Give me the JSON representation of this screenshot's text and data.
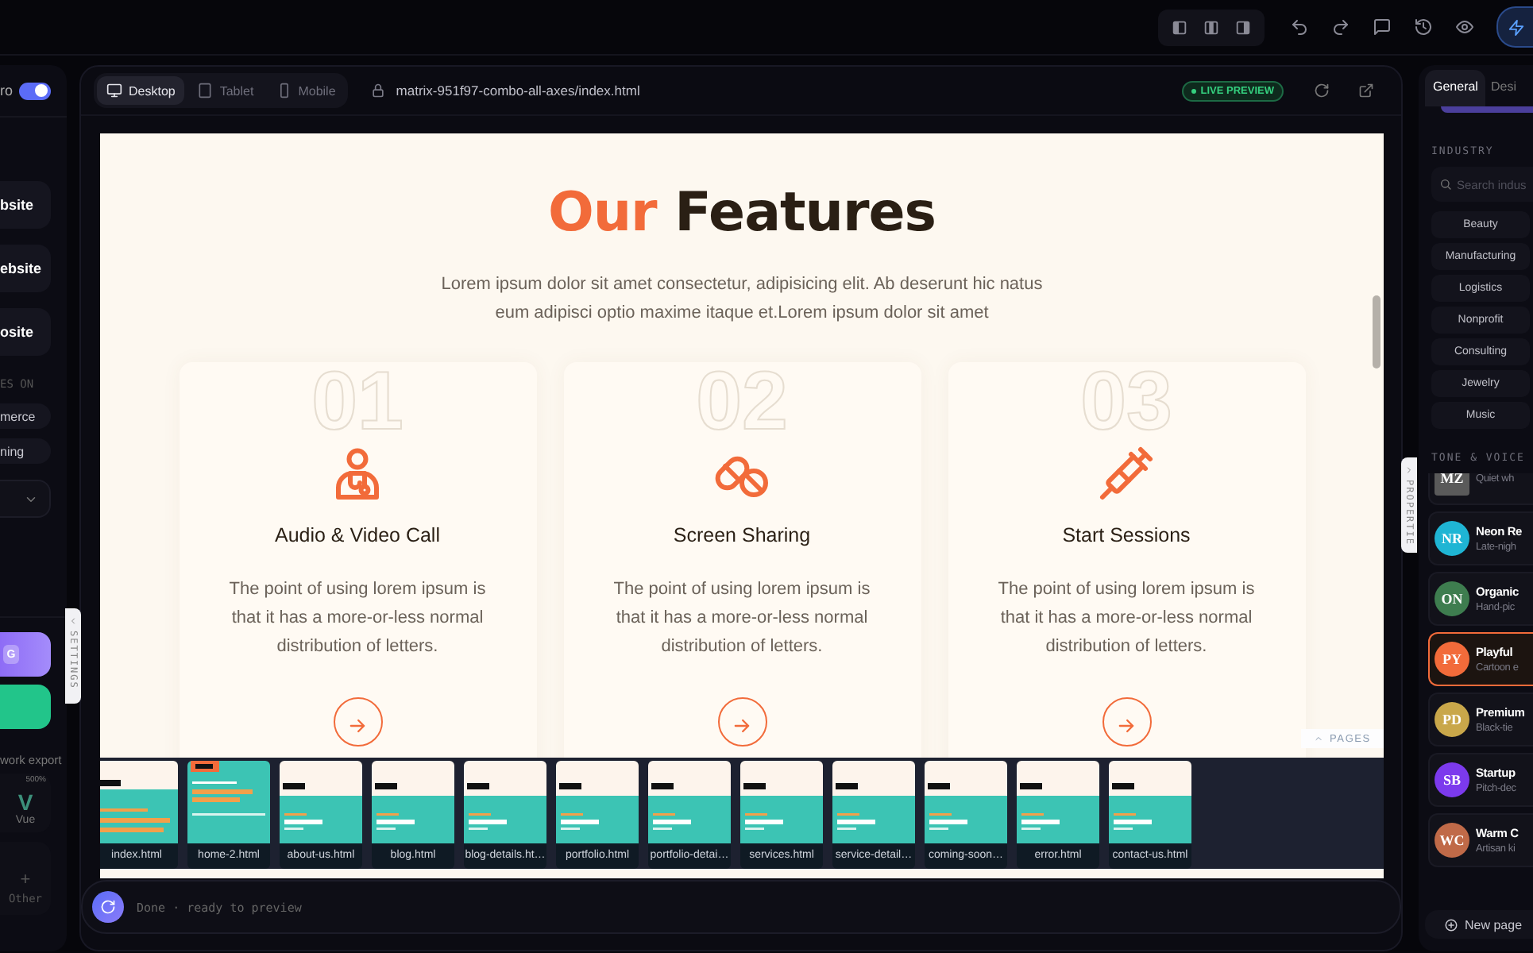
{
  "left_panel": {
    "toggle": {
      "label": "ro",
      "on": true
    },
    "site_buttons": [
      "bsite",
      "ebsite",
      "osite"
    ],
    "section_label": "ES ON",
    "chips": [
      "merce",
      "ning"
    ],
    "action_buttons": [
      {
        "kind": "primary",
        "badge": "G"
      },
      {
        "kind": "success"
      }
    ],
    "export_label": "work export",
    "export_options": [
      {
        "glyph": "V",
        "name": "Vue",
        "badge": "500%"
      },
      {
        "glyph": "+",
        "name": "Other"
      }
    ]
  },
  "toolbar": {
    "devices": [
      {
        "label": "Desktop",
        "selected": true
      },
      {
        "label": "Tablet",
        "selected": false
      },
      {
        "label": "Mobile",
        "selected": false
      }
    ],
    "url": "matrix-951f97-combo-all-axes/index.html",
    "live_badge": "LIVE PREVIEW"
  },
  "preview": {
    "title_accent": "Our",
    "title_rest": "Features",
    "intro": "Lorem ipsum dolor sit amet consectetur, adipisicing elit. Ab deserunt hic natus eum adipisci optio maxime itaque et.Lorem ipsum dolor sit amet",
    "features": [
      {
        "number": "01",
        "title": "Audio & Video Call",
        "text": "The point of using lorem ipsum is that it has a more-or-less normal distribution of letters."
      },
      {
        "number": "02",
        "title": "Screen Sharing",
        "text": "The point of using lorem ipsum is that it has a more-or-less normal distribution of letters."
      },
      {
        "number": "03",
        "title": "Start Sessions",
        "text": "The point of using lorem ipsum is that it has a more-or-less normal distribution of letters."
      }
    ],
    "pages_tab": "PAGES",
    "pages": [
      {
        "file": "index.html",
        "kind": "hero"
      },
      {
        "file": "home-2.html",
        "kind": "banner"
      },
      {
        "file": "about-us.html",
        "kind": "inner"
      },
      {
        "file": "blog.html",
        "kind": "inner"
      },
      {
        "file": "blog-details.ht…",
        "kind": "inner"
      },
      {
        "file": "portfolio.html",
        "kind": "inner"
      },
      {
        "file": "portfolio-detai…",
        "kind": "inner"
      },
      {
        "file": "services.html",
        "kind": "inner"
      },
      {
        "file": "service-detail…",
        "kind": "inner"
      },
      {
        "file": "coming-soon…",
        "kind": "inner"
      },
      {
        "file": "error.html",
        "kind": "inner"
      },
      {
        "file": "contact-us.html",
        "kind": "inner"
      }
    ]
  },
  "status_bar": {
    "text": "Done · ready to preview"
  },
  "side_tabs": {
    "settings": "SETTINGS",
    "properties": "PROPERTIE"
  },
  "right_panel": {
    "tabs": [
      {
        "label": "General",
        "selected": true
      },
      {
        "label": "Desi",
        "selected": false
      }
    ],
    "industry_label": "INDUSTRY",
    "search_placeholder": "Search indus",
    "industries": [
      "Beauty",
      "Manufacturing",
      "Logistics",
      "Nonprofit",
      "Consulting",
      "Jewelry",
      "Music"
    ],
    "tone_label": "TONE & VOICE",
    "tones": [
      {
        "initials": "MZ",
        "subtitle": "Quiet wh",
        "color": "#5a5a5a",
        "selected": false
      },
      {
        "initials": "NR",
        "name": "Neon Re",
        "subtitle": "Late-nigh",
        "color": "#1fb5d4",
        "selected": false
      },
      {
        "initials": "ON",
        "name": "Organic",
        "subtitle": "Hand-pic",
        "color": "#3e7d4f",
        "selected": false
      },
      {
        "initials": "PY",
        "name": "Playful",
        "subtitle": "Cartoon e",
        "color": "#f26b3a",
        "selected": true
      },
      {
        "initials": "PD",
        "name": "Premium",
        "subtitle": "Black-tie",
        "color": "#c9a74a",
        "selected": false
      },
      {
        "initials": "SB",
        "name": "Startup",
        "subtitle": "Pitch-dec",
        "color": "#7c3aed",
        "selected": false
      },
      {
        "initials": "WC",
        "name": "Warm C",
        "subtitle": "Artisan ki",
        "color": "#c06a48",
        "selected": false
      }
    ],
    "new_page": "New page"
  }
}
